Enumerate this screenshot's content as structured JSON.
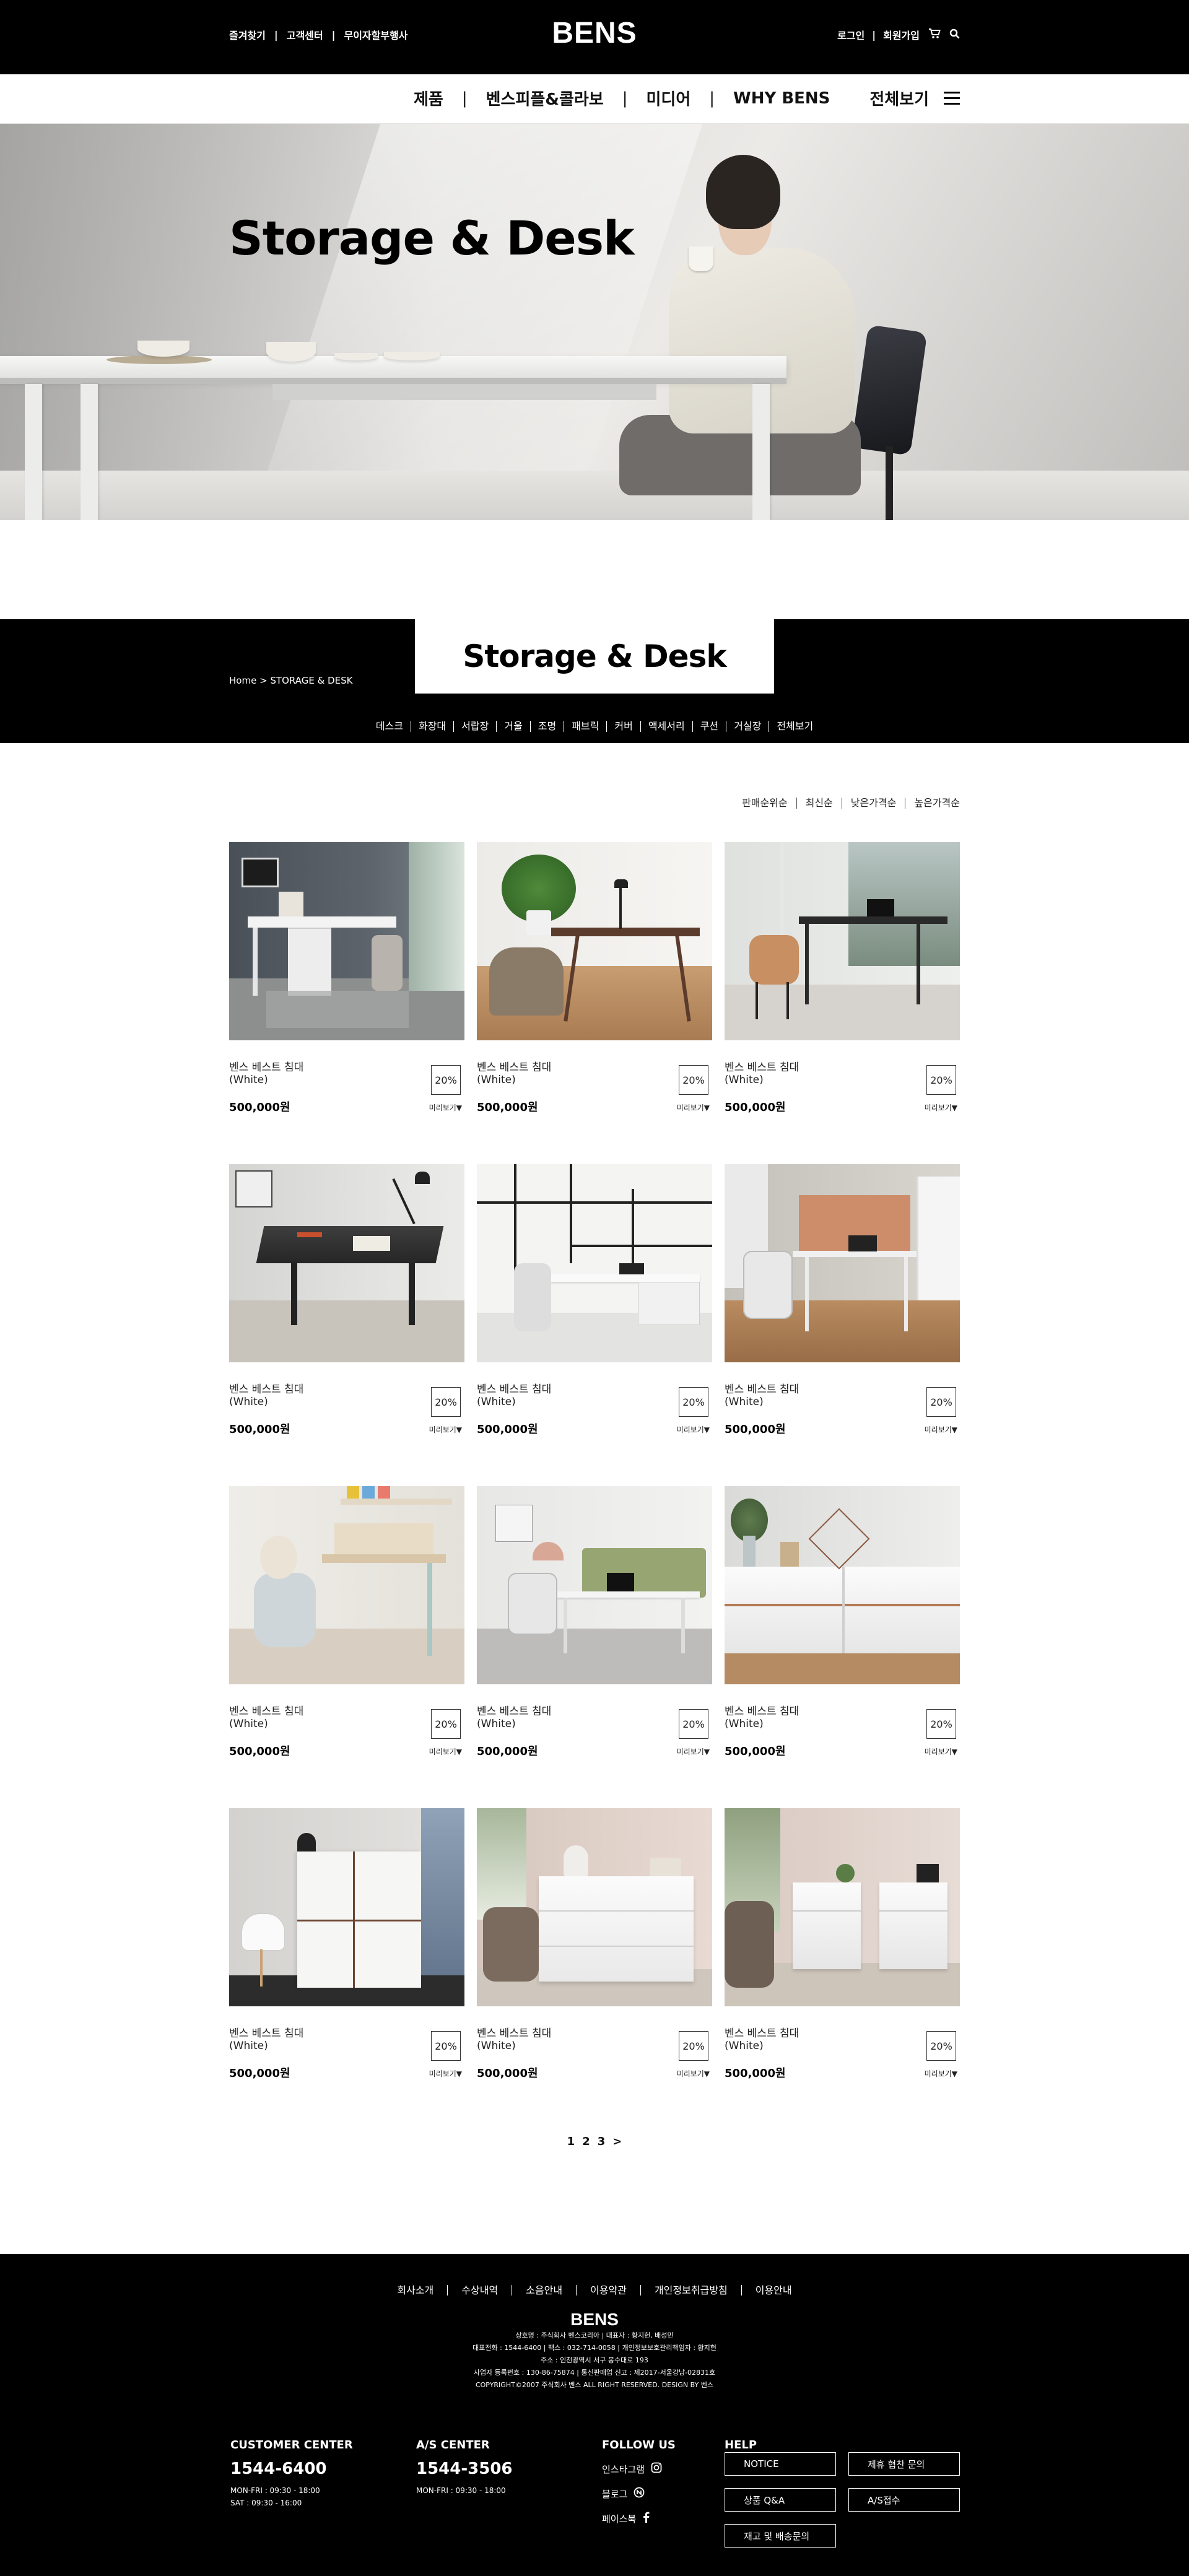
{
  "header": {
    "util_left": [
      "즐겨찾기",
      "고객센터",
      "무이자할부행사"
    ],
    "logo": "BENS",
    "util_right": [
      "로그인",
      "회원가입"
    ],
    "cart_icon": "cart-icon",
    "search_icon": "search-icon"
  },
  "nav": {
    "items": [
      "제품",
      "벤스피플&콜라보",
      "미디어",
      "WHY BENS"
    ],
    "all_view": "전체보기",
    "menu_icon": "hamburger-icon"
  },
  "hero": {
    "title": "Storage & Desk"
  },
  "category": {
    "breadcrumb": "Home > STORAGE & DESK",
    "title": "Storage & Desk",
    "items": [
      "데스크",
      "화장대",
      "서랍장",
      "거울",
      "조명",
      "패브릭",
      "커버",
      "액세서리",
      "쿠션",
      "거실장",
      "전체보기"
    ]
  },
  "sort": {
    "options": [
      "판매순위순",
      "최신순",
      "낮은가격순",
      "높은가격순"
    ]
  },
  "products": [
    {
      "name": "벤스 베스트 침대",
      "color": "(White)",
      "price": "500,000원",
      "discount": "20%",
      "more": "미리보기▼"
    },
    {
      "name": "벤스 베스트 침대",
      "color": "(White)",
      "price": "500,000원",
      "discount": "20%",
      "more": "미리보기▼"
    },
    {
      "name": "벤스 베스트 침대",
      "color": "(White)",
      "price": "500,000원",
      "discount": "20%",
      "more": "미리보기▼"
    },
    {
      "name": "벤스 베스트 침대",
      "color": "(White)",
      "price": "500,000원",
      "discount": "20%",
      "more": "미리보기▼"
    },
    {
      "name": "벤스 베스트 침대",
      "color": "(White)",
      "price": "500,000원",
      "discount": "20%",
      "more": "미리보기▼"
    },
    {
      "name": "벤스 베스트 침대",
      "color": "(White)",
      "price": "500,000원",
      "discount": "20%",
      "more": "미리보기▼"
    },
    {
      "name": "벤스 베스트 침대",
      "color": "(White)",
      "price": "500,000원",
      "discount": "20%",
      "more": "미리보기▼"
    },
    {
      "name": "벤스 베스트 침대",
      "color": "(White)",
      "price": "500,000원",
      "discount": "20%",
      "more": "미리보기▼"
    },
    {
      "name": "벤스 베스트 침대",
      "color": "(White)",
      "price": "500,000원",
      "discount": "20%",
      "more": "미리보기▼"
    },
    {
      "name": "벤스 베스트 침대",
      "color": "(White)",
      "price": "500,000원",
      "discount": "20%",
      "more": "미리보기▼"
    },
    {
      "name": "벤스 베스트 침대",
      "color": "(White)",
      "price": "500,000원",
      "discount": "20%",
      "more": "미리보기▼"
    },
    {
      "name": "벤스 베스트 침대",
      "color": "(White)",
      "price": "500,000원",
      "discount": "20%",
      "more": "미리보기▼"
    }
  ],
  "pagination": {
    "pages": [
      "1",
      "2",
      "3"
    ],
    "next": ">"
  },
  "footer": {
    "links": [
      "회사소개",
      "수상내역",
      "소음안내",
      "이용약관",
      "개인정보취급방침",
      "이용안내"
    ],
    "logo": "BENS",
    "info": [
      "상호명 : 주식회사 벤스코리아  |  대표자 : 황지헌, 배성민",
      "대표전화 : 1544-6400  |  팩스 : 032-714-0058  |  개인정보보호관리책임자 : 황지헌",
      "주소 : 인천광역시 서구 봉수대로 193",
      "사업자 등록번호 : 130-86-75874  |  통신판매업 신고 : 제2017-서울강남-02831호",
      "COPYRIGHT©2007 주식회사 벤스 ALL RIGHT RESERVED. DESIGN BY 벤스"
    ],
    "customer_center": {
      "title": "CUSTOMER CENTER",
      "phone": "1544-6400",
      "hours": [
        "MON-FRI : 09:30 - 18:00",
        "SAT : 09:30 - 16:00"
      ]
    },
    "as_center": {
      "title": "A/S CENTER",
      "phone": "1544-3506",
      "hours": [
        "MON-FRI : 09:30 - 18:00"
      ]
    },
    "follow": {
      "title": "FOLLOW US",
      "items": [
        "인스타그램",
        "블로그",
        "페이스북"
      ]
    },
    "help": {
      "title": "HELP",
      "buttons": [
        "NOTICE",
        "제휴 협찬 문의",
        "상품 Q&A",
        "A/S접수",
        "재고 및 배송문의"
      ]
    }
  },
  "colors": {
    "header_bg": "#000000",
    "accent": "#000000",
    "page_bg": "#ffffff"
  }
}
